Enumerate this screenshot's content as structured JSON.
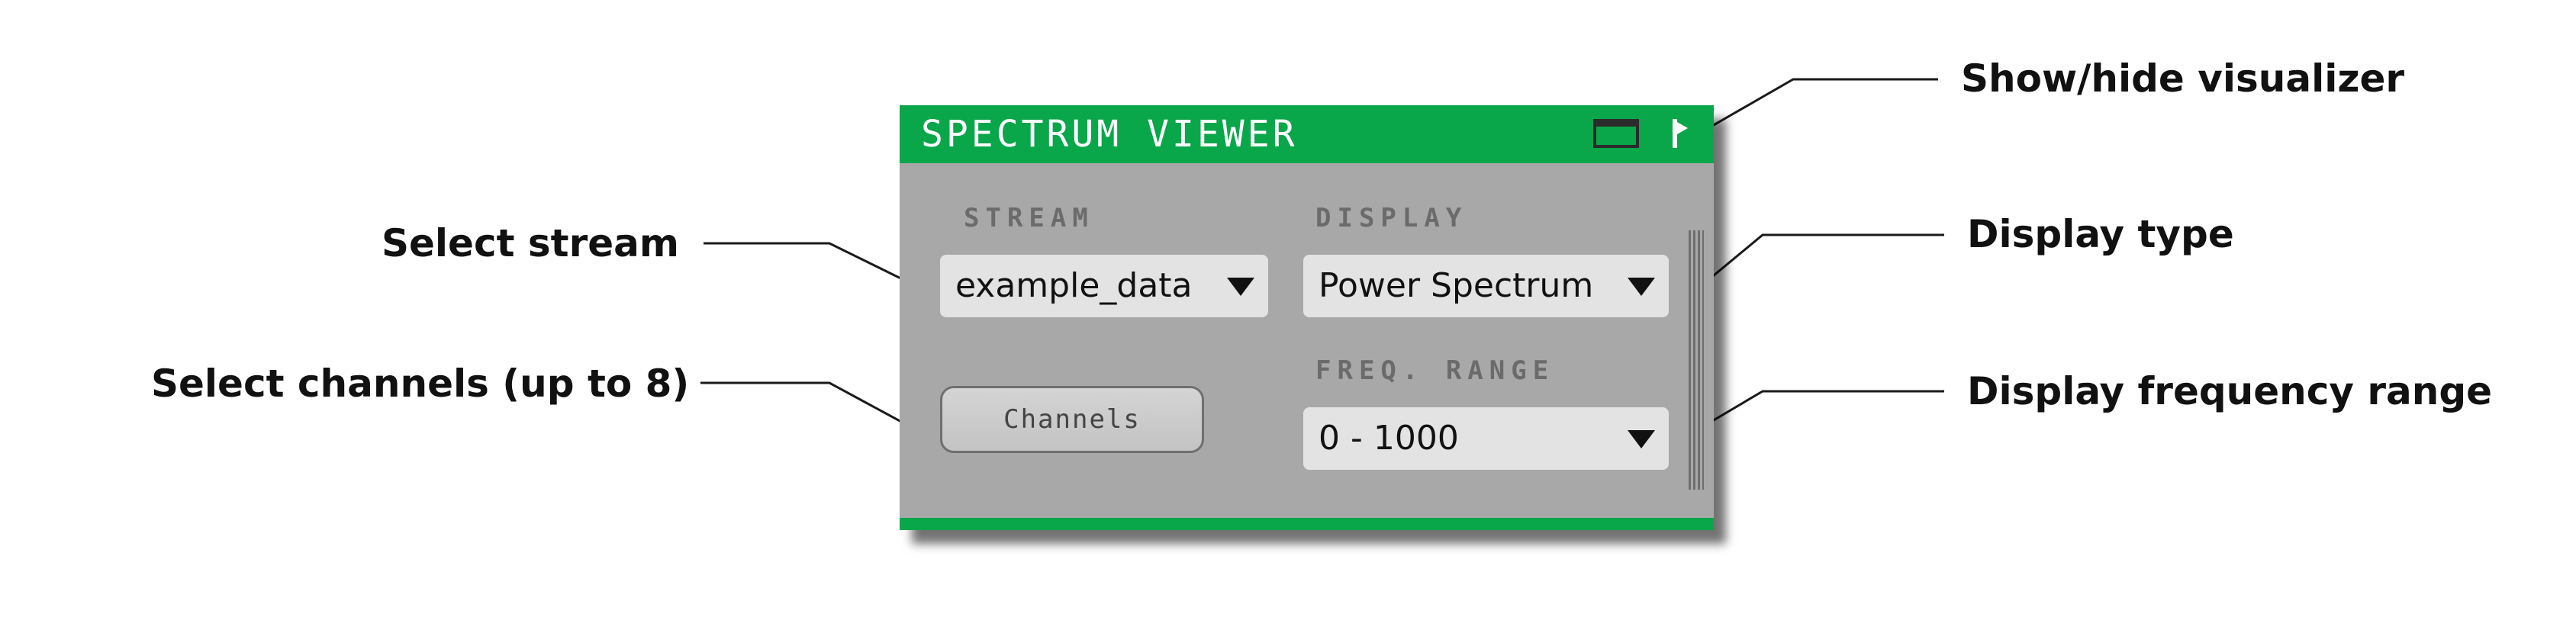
{
  "callouts": {
    "show_hide": "Show/hide visualizer",
    "select_stream": "Select stream",
    "display_type": "Display type",
    "select_channels": "Select channels (up to 8)",
    "display_freq_range": "Display frequency range"
  },
  "editor": {
    "title": "SPECTRUM VIEWER",
    "stream_label": "STREAM",
    "stream_value": "example_data",
    "display_label": "DISPLAY",
    "display_value": "Power Spectrum",
    "freq_label": "FREQ. RANGE",
    "freq_value": "0 - 1000",
    "channels_button": "Channels"
  },
  "colors": {
    "accent": "#0aa64a",
    "panel": "#a8a8a8",
    "combo": "#e3e3e3"
  },
  "icons": {
    "window": "window-icon",
    "toggle": "visualizer-toggle-icon",
    "dropdown": "triangle-down-icon"
  }
}
